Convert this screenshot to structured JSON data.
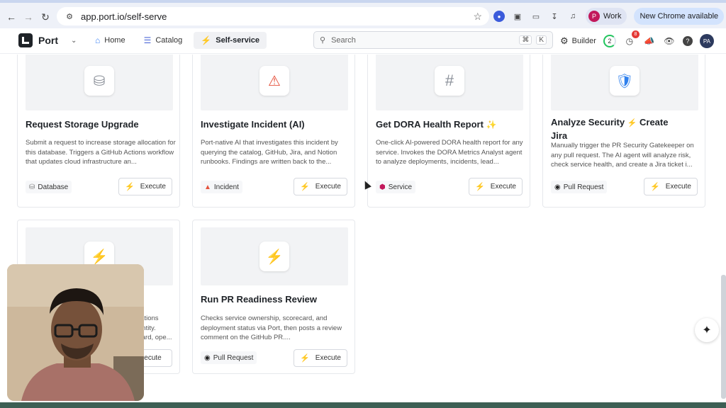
{
  "browser": {
    "url": "app.port.io/self-serve",
    "profile_initial": "P",
    "profile_name": "Work",
    "update_label": "New Chrome available"
  },
  "app": {
    "logo_text": "Port",
    "nav": [
      {
        "label": "Home",
        "icon": "home-icon"
      },
      {
        "label": "Catalog",
        "icon": "catalog-icon"
      },
      {
        "label": "Self-service",
        "icon": "bolt-icon",
        "active": true
      }
    ],
    "search_placeholder": "Search",
    "search_shortcut": [
      "⌘",
      "K"
    ],
    "builder_label": "Builder",
    "progress_count": "2",
    "notifications_count": "8",
    "user_initials": "PA"
  },
  "cards": [
    {
      "title": "Request Storage Upgrade",
      "icon": "database-icon",
      "description": "Submit a request to increase storage allocation for this database. Triggers a GitHub Actions workflow that updates cloud infrastructure an...",
      "tag": "Database",
      "tag_icon": "database-icon",
      "execute": "Execute"
    },
    {
      "title": "Investigate Incident (AI)",
      "icon": "warning-icon",
      "description": "Port-native AI that investigates this incident by querying the catalog, GitHub, Jira, and Notion runbooks. Findings are written back to the...",
      "tag": "Incident",
      "tag_icon": "warning-icon",
      "execute": "Execute"
    },
    {
      "title": "Get DORA Health Report",
      "icon": "hash-icon",
      "description": "One-click AI-powered DORA health report for any service. Invokes the DORA Metrics Analyst agent to analyze deployments, incidents, lead...",
      "tag": "Service",
      "tag_icon": "cube-icon",
      "execute": "Execute"
    },
    {
      "title_part1": "Analyze Security",
      "title_part2": "Create",
      "title_part3": "Jira",
      "icon": "shield-icon",
      "description": "Manually trigger the PR Security Gatekeeper on any pull request. The AI agent will analyze risk, check service health, and create a Jira ticket i...",
      "tag": "Pull Request",
      "tag_icon": "github-icon",
      "execute": "Execute"
    },
    {
      "icon": "bolt-icon",
      "description_visible": "rations\nentity.\ncard, ope...",
      "execute_visible": "xecute"
    },
    {
      "title": "Run PR Readiness Review",
      "icon": "bolt-icon",
      "description": "Checks service ownership, scorecard, and deployment status via Port, then posts a review comment on the GitHub PR....",
      "tag": "Pull Request",
      "tag_icon": "github-icon",
      "execute": "Execute"
    }
  ],
  "colors": {
    "accent_bolt": "#f4b400",
    "warning": "#e5533d",
    "shield": "#2f80ed",
    "service_cube": "#c2185b",
    "brand_dark": "#1f2328"
  }
}
